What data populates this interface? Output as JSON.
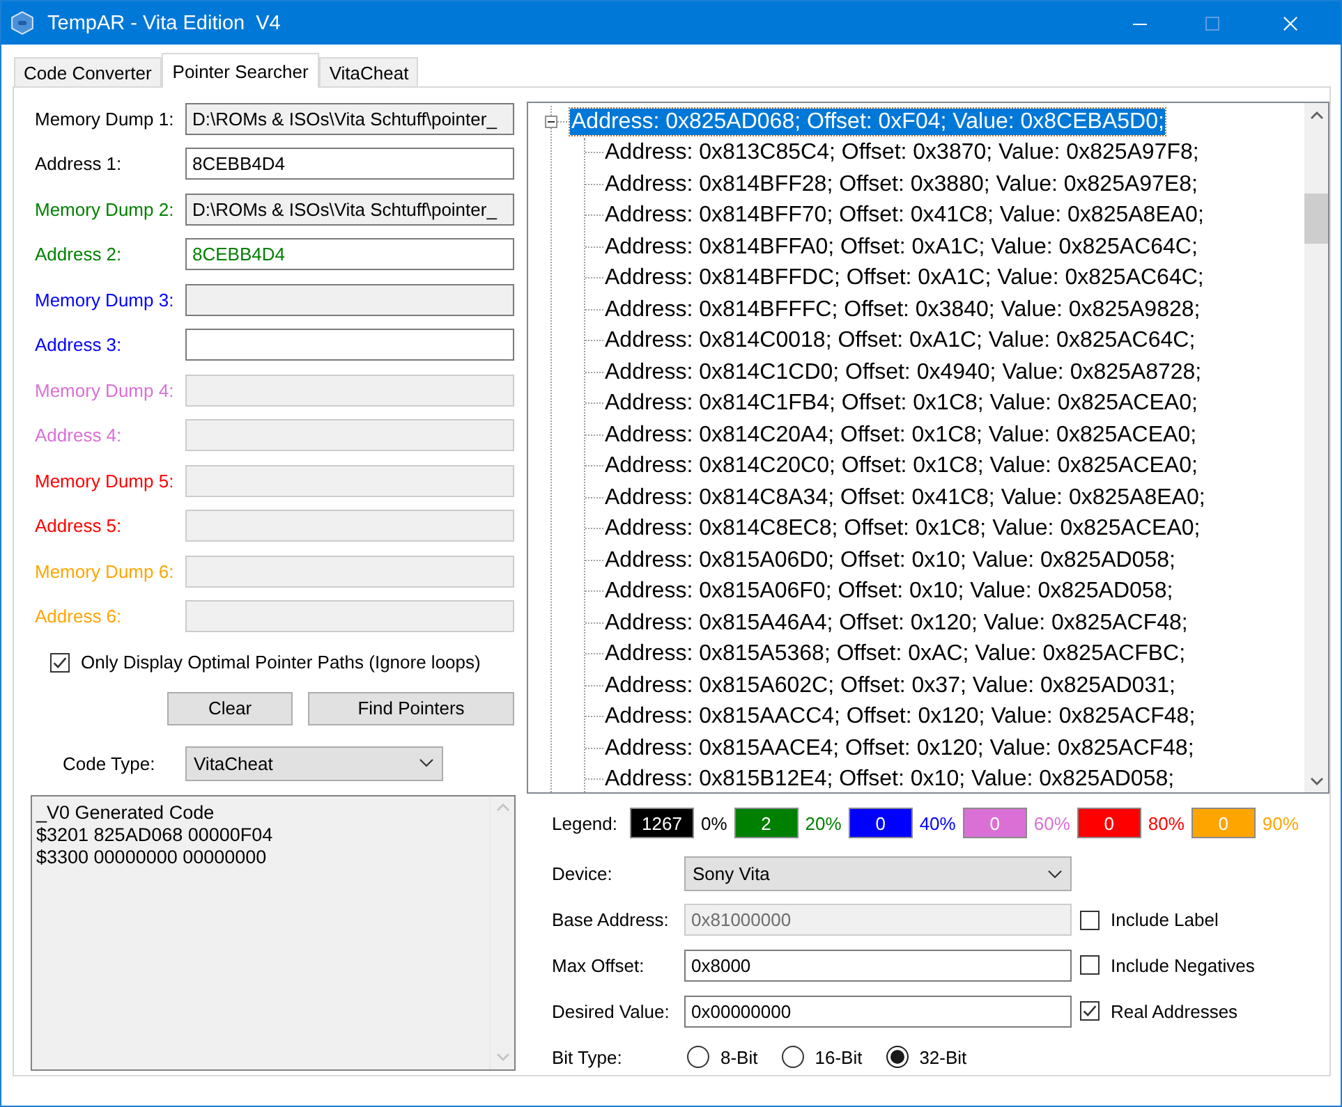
{
  "window": {
    "title": "TempAR - Vita Edition  V4"
  },
  "tabs": [
    {
      "label": "Code Converter",
      "selected": false
    },
    {
      "label": "Pointer Searcher",
      "selected": true
    },
    {
      "label": "VitaCheat",
      "selected": false
    }
  ],
  "dumps": [
    {
      "color": "#000000",
      "memory_dump": {
        "label": "Memory Dump 1:",
        "value": "D:\\ROMs & ISOs\\Vita Schtuff\\pointer_",
        "disabled": false
      },
      "address": {
        "label": "Address 1:",
        "value": "8CEBB4D4",
        "disabled": false
      }
    },
    {
      "color": "#008000",
      "memory_dump": {
        "label": "Memory Dump 2:",
        "value": "D:\\ROMs & ISOs\\Vita Schtuff\\pointer_",
        "disabled": false
      },
      "address": {
        "label": "Address 2:",
        "value": "8CEBB4D4",
        "disabled": false
      }
    },
    {
      "color": "#0000ff",
      "memory_dump": {
        "label": "Memory Dump 3:",
        "disabled": false
      },
      "address": {
        "label": "Address 3:",
        "disabled": false
      }
    },
    {
      "color": "#da70d6",
      "memory_dump": {
        "label": "Memory Dump 4:",
        "disabled": true
      },
      "address": {
        "label": "Address 4:",
        "disabled": true
      }
    },
    {
      "color": "#ff0000",
      "memory_dump": {
        "label": "Memory Dump 5:",
        "disabled": true
      },
      "address": {
        "label": "Address 5:",
        "disabled": true
      }
    },
    {
      "color": "#ffa500",
      "memory_dump": {
        "label": "Memory Dump 6:",
        "disabled": true
      },
      "address": {
        "label": "Address 6:",
        "disabled": true
      }
    }
  ],
  "only_optimal": {
    "label": "Only Display Optimal Pointer Paths (Ignore loops)",
    "checked": true
  },
  "buttons": [
    "Clear",
    "Find Pointers"
  ],
  "code_type": {
    "label": "Code Type:",
    "value": "VitaCheat"
  },
  "generated_code": {
    "lines": [
      "_V0 Generated Code",
      "$3201 825AD068 00000F04",
      "$3300 00000000 00000000"
    ]
  },
  "results_tree": {
    "items": [
      {
        "text": "Address: 0x825AD068; Offset: 0xF04; Value: 0x8CEBA5D0;",
        "selected": true,
        "expanded": true,
        "children": [
          {
            "text": "Address: 0x813C85C4; Offset: 0x3870; Value: 0x825A97F8;",
            "selected": false
          },
          {
            "text": "Address: 0x814BFF28; Offset: 0x3880; Value: 0x825A97E8;",
            "selected": false
          },
          {
            "text": "Address: 0x814BFF70; Offset: 0x41C8; Value: 0x825A8EA0;",
            "selected": false
          },
          {
            "text": "Address: 0x814BFFA0; Offset: 0xA1C; Value: 0x825AC64C;",
            "selected": false
          },
          {
            "text": "Address: 0x814BFFDC; Offset: 0xA1C; Value: 0x825AC64C;",
            "selected": false
          },
          {
            "text": "Address: 0x814BFFFC; Offset: 0x3840; Value: 0x825A9828;",
            "selected": false
          },
          {
            "text": "Address: 0x814C0018; Offset: 0xA1C; Value: 0x825AC64C;",
            "selected": false
          },
          {
            "text": "Address: 0x814C1CD0; Offset: 0x4940; Value: 0x825A8728;",
            "selected": false
          },
          {
            "text": "Address: 0x814C1FB4; Offset: 0x1C8; Value: 0x825ACEA0;",
            "selected": false
          },
          {
            "text": "Address: 0x814C20A4; Offset: 0x1C8; Value: 0x825ACEA0;",
            "selected": false
          },
          {
            "text": "Address: 0x814C20C0; Offset: 0x1C8; Value: 0x825ACEA0;",
            "selected": false
          },
          {
            "text": "Address: 0x814C8A34; Offset: 0x41C8; Value: 0x825A8EA0;",
            "selected": false
          },
          {
            "text": "Address: 0x814C8EC8; Offset: 0x1C8; Value: 0x825ACEA0;",
            "selected": false
          },
          {
            "text": "Address: 0x815A06D0; Offset: 0x10; Value: 0x825AD058;",
            "selected": false
          },
          {
            "text": "Address: 0x815A06F0; Offset: 0x10; Value: 0x825AD058;",
            "selected": false
          },
          {
            "text": "Address: 0x815A46A4; Offset: 0x120; Value: 0x825ACF48;",
            "selected": false
          },
          {
            "text": "Address: 0x815A5368; Offset: 0xAC; Value: 0x825ACFBC;",
            "selected": false
          },
          {
            "text": "Address: 0x815A602C; Offset: 0x37; Value: 0x825AD031;",
            "selected": false
          },
          {
            "text": "Address: 0x815AACC4; Offset: 0x120; Value: 0x825ACF48;",
            "selected": false
          },
          {
            "text": "Address: 0x815AACE4; Offset: 0x120; Value: 0x825ACF48;",
            "selected": false
          },
          {
            "text": "Address: 0x815B12E4; Offset: 0x10; Value: 0x825AD058;",
            "selected": false
          }
        ]
      }
    ]
  },
  "legend": {
    "label": "Legend:",
    "items": [
      {
        "count": "1267",
        "percent": "0%",
        "color": "#000000"
      },
      {
        "count": "2",
        "percent": "20%",
        "color": "#008000"
      },
      {
        "count": "0",
        "percent": "40%",
        "color": "#0000ff"
      },
      {
        "count": "0",
        "percent": "60%",
        "color": "#da70d6"
      },
      {
        "count": "0",
        "percent": "80%",
        "color": "#ff0000"
      },
      {
        "count": "0",
        "percent": "90%",
        "color": "#ffa500"
      }
    ]
  },
  "device": {
    "label": "Device:",
    "value": "Sony Vita"
  },
  "base_address": {
    "label": "Base Address:",
    "value": "0x81000000",
    "disabled": true
  },
  "max_offset": {
    "label": "Max Offset:",
    "value": "0x8000",
    "disabled": false
  },
  "desired_value": {
    "label": "Desired Value:",
    "value": "0x00000000",
    "disabled": false
  },
  "options": [
    {
      "label": "Include Label",
      "checked": false
    },
    {
      "label": "Include Negatives",
      "checked": false
    },
    {
      "label": "Real Addresses",
      "checked": true
    }
  ],
  "bit_type": {
    "label": "Bit Type:",
    "options": [
      {
        "label": "8-Bit",
        "selected": false
      },
      {
        "label": "16-Bit",
        "selected": false
      },
      {
        "label": "32-Bit",
        "selected": true
      }
    ]
  }
}
